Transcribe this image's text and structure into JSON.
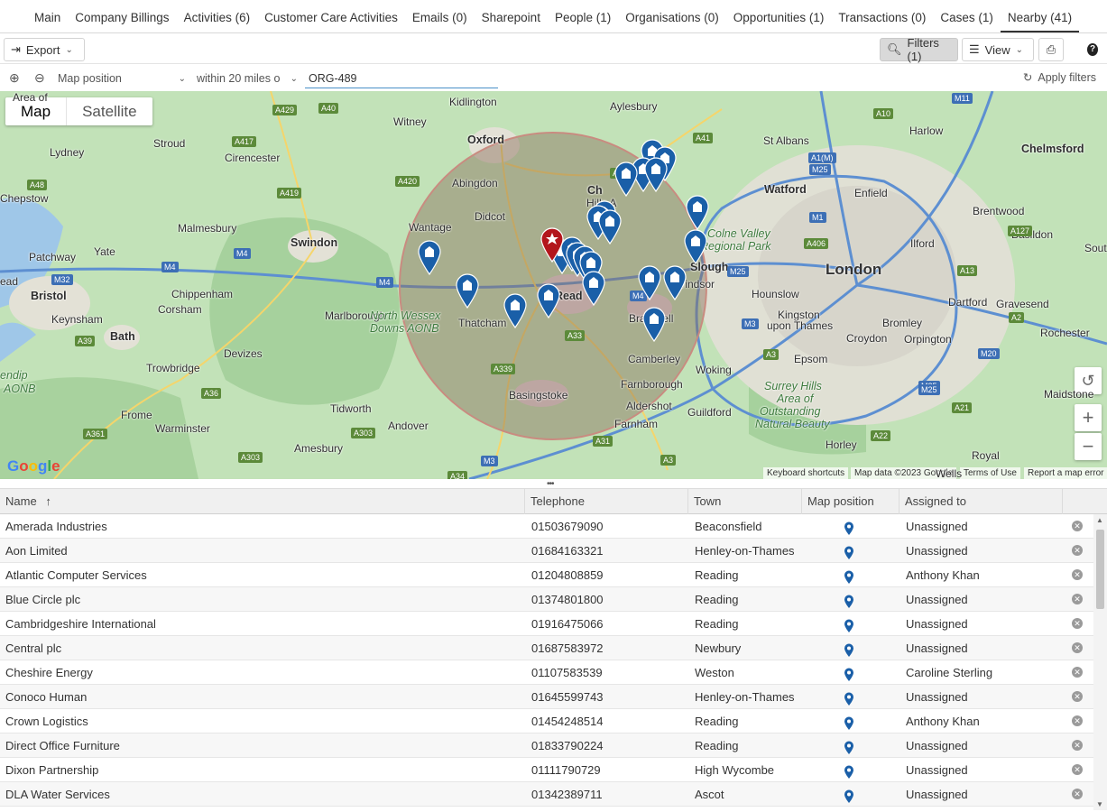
{
  "tabs": [
    "Main",
    "Company Billings",
    "Activities (6)",
    "Customer Care Activities",
    "Emails (0)",
    "Sharepoint",
    "People (1)",
    "Organisations (0)",
    "Opportunities (1)",
    "Transactions (0)",
    "Cases (1)",
    "Nearby (41)"
  ],
  "active_tab": "Nearby (41)",
  "toolbar": {
    "export_label": "Export",
    "filters_label": "Filters (1)",
    "view_label": "View"
  },
  "filter": {
    "field": "Map position",
    "distance": "within 20 miles o",
    "value": "ORG-489",
    "apply_label": "Apply filters"
  },
  "map": {
    "type_map": "Map",
    "type_satellite": "Satellite",
    "places": [
      {
        "t": "Kidlington",
        "c": "mid"
      },
      {
        "t": "Aylesbury",
        "c": "mid"
      },
      {
        "t": "Witney",
        "c": "mid"
      },
      {
        "t": "Oxford",
        "c": "big2"
      },
      {
        "t": "Stroud",
        "c": "mid"
      },
      {
        "t": "Lydney",
        "c": "mid"
      },
      {
        "t": "Cirencester",
        "c": "mid"
      },
      {
        "t": "Abingdon",
        "c": "mid"
      },
      {
        "t": "Didcot",
        "c": "mid"
      },
      {
        "t": "Wantage",
        "c": "mid"
      },
      {
        "t": "Malmesbury",
        "c": "mid"
      },
      {
        "t": "Swindon",
        "c": "big2"
      },
      {
        "t": "Yate",
        "c": "mid"
      },
      {
        "t": "Patchway",
        "c": "mid"
      },
      {
        "t": "Bristol",
        "c": "big2"
      },
      {
        "t": "Keynsham",
        "c": "mid"
      },
      {
        "t": "Bath",
        "c": "big2"
      },
      {
        "t": "Chippenham",
        "c": "mid"
      },
      {
        "t": "Corsham",
        "c": "mid"
      },
      {
        "t": "Marlborough",
        "c": "mid"
      },
      {
        "t": "Devizes",
        "c": "mid"
      },
      {
        "t": "Trowbridge",
        "c": "mid"
      },
      {
        "t": "Frome",
        "c": "mid"
      },
      {
        "t": "Warminster",
        "c": "mid"
      },
      {
        "t": "Tidworth",
        "c": "mid"
      },
      {
        "t": "Andover",
        "c": "mid"
      },
      {
        "t": "Amesbury",
        "c": "mid"
      },
      {
        "t": "Thatcham",
        "c": "mid"
      },
      {
        "t": "Basingstoke",
        "c": "mid"
      },
      {
        "t": "Read",
        "c": "big2"
      },
      {
        "t": "Bracknell",
        "c": "mid"
      },
      {
        "t": "Camberley",
        "c": "mid"
      },
      {
        "t": "Farnborough",
        "c": "mid"
      },
      {
        "t": "Aldershot",
        "c": "mid"
      },
      {
        "t": "Farnham",
        "c": "mid"
      },
      {
        "t": "Woking",
        "c": "mid"
      },
      {
        "t": "Guildford",
        "c": "mid"
      },
      {
        "t": "Windsor",
        "c": "mid"
      },
      {
        "t": "Hounslow",
        "c": "mid"
      },
      {
        "t": "Kingston",
        "c": "mid"
      },
      {
        "t": "upon Thames",
        "c": "mid"
      },
      {
        "t": "Croydon",
        "c": "mid"
      },
      {
        "t": "Epsom",
        "c": "mid"
      },
      {
        "t": "Bromley",
        "c": "mid"
      },
      {
        "t": "Orpington",
        "c": "mid"
      },
      {
        "t": "London",
        "c": "big"
      },
      {
        "t": "Watford",
        "c": "big2"
      },
      {
        "t": "St Albans",
        "c": "mid"
      },
      {
        "t": "Harlow",
        "c": "mid"
      },
      {
        "t": "Enfield",
        "c": "mid"
      },
      {
        "t": "Brentwood",
        "c": "mid"
      },
      {
        "t": "Ilford",
        "c": "mid"
      },
      {
        "t": "Basildon",
        "c": "mid"
      },
      {
        "t": "Chelmsford",
        "c": "big2"
      },
      {
        "t": "Dartford",
        "c": "mid"
      },
      {
        "t": "Gravesend",
        "c": "mid"
      },
      {
        "t": "Rochester",
        "c": "mid"
      },
      {
        "t": "Maidstone",
        "c": "mid"
      },
      {
        "t": "Horley",
        "c": "mid"
      },
      {
        "t": "Royal",
        "c": "mid"
      },
      {
        "t": "Wells",
        "c": "mid"
      },
      {
        "t": "Sout",
        "c": "mid"
      },
      {
        "t": "Chepstow",
        "c": "mid"
      },
      {
        "t": "Ch",
        "c": "big2"
      },
      {
        "t": "Hills A",
        "c": "mid"
      },
      {
        "t": "Slough",
        "c": "big2"
      },
      {
        "t": "ead",
        "c": "mid"
      },
      {
        "t": "Area of",
        "c": "mid"
      }
    ],
    "green_labels": [
      "North Wessex",
      "Downs AONB",
      "Colne Valley",
      "Regional Park",
      "Surrey Hills",
      "Area of",
      "Outstanding",
      "Natural Beauty",
      "endip",
      "AONB"
    ],
    "roads": [
      "A429",
      "A40",
      "A417",
      "A419",
      "A420",
      "A48",
      "M4",
      "M4",
      "M4",
      "M32",
      "A39",
      "A36",
      "A361",
      "A303",
      "A303",
      "A339",
      "A33",
      "M3",
      "A31",
      "A34",
      "A3",
      "M3",
      "M25",
      "M25",
      "M1",
      "A1(M)",
      "M25",
      "A10",
      "M11",
      "A41",
      "A406",
      "A127",
      "A13",
      "A2",
      "A21",
      "A22",
      "M20",
      "M25",
      "A3",
      "A4010",
      "M4"
    ],
    "attribution": [
      "Keyboard shortcuts",
      "Map data ©2023 Google",
      "Terms of Use",
      "Report a map error"
    ],
    "google_letters": [
      "G",
      "o",
      "o",
      "g",
      "l",
      "e"
    ],
    "google_colors": [
      "#4285F4",
      "#EA4335",
      "#FBBC05",
      "#4285F4",
      "#34A853",
      "#EA4335"
    ]
  },
  "table": {
    "columns": [
      "Name",
      "Telephone",
      "Town",
      "Map position",
      "Assigned to"
    ],
    "rows": [
      [
        "Amerada Industries",
        "01503679090",
        "Beaconsfield",
        "Unassigned"
      ],
      [
        "Aon Limited",
        "01684163321",
        "Henley-on-Thames",
        "Unassigned"
      ],
      [
        "Atlantic Computer Services",
        "01204808859",
        "Reading",
        "Anthony Khan"
      ],
      [
        "Blue Circle plc",
        "01374801800",
        "Reading",
        "Unassigned"
      ],
      [
        "Cambridgeshire International",
        "01916475066",
        "Reading",
        "Unassigned"
      ],
      [
        "Central plc",
        "01687583972",
        "Newbury",
        "Unassigned"
      ],
      [
        "Cheshire Energy",
        "01107583539",
        "Weston",
        "Caroline Sterling"
      ],
      [
        "Conoco Human",
        "01645599743",
        "Henley-on-Thames",
        "Unassigned"
      ],
      [
        "Crown Logistics",
        "01454248514",
        "Reading",
        "Anthony Khan"
      ],
      [
        "Direct Office Furniture",
        "01833790224",
        "Reading",
        "Unassigned"
      ],
      [
        "Dixon Partnership",
        "01111790729",
        "High Wycombe",
        "Unassigned"
      ],
      [
        "DLA Water Services",
        "01342389711",
        "Ascot",
        "Unassigned"
      ]
    ]
  },
  "colors": {
    "pin_blue": "#1a5fa8",
    "pin_red": "#b3161c",
    "radius_fill": "#8a6e5a",
    "accent": "#4a90c8"
  }
}
